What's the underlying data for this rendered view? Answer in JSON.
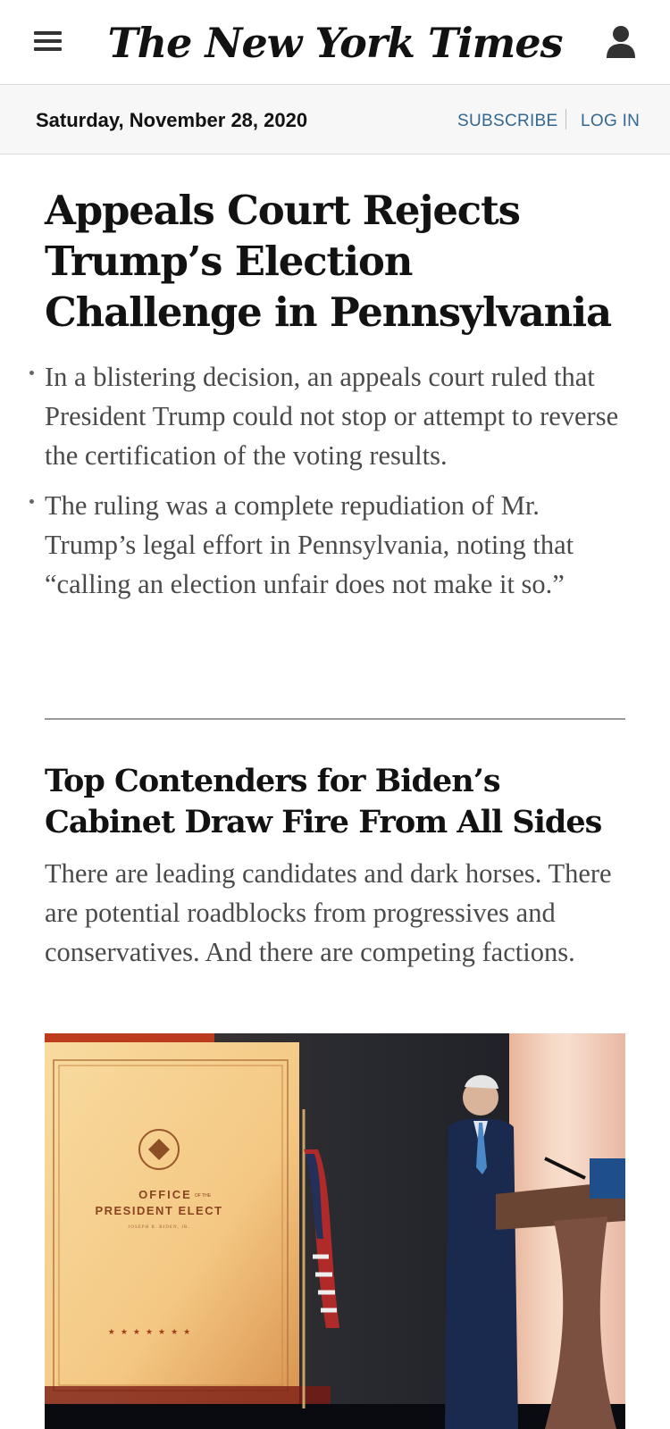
{
  "header": {
    "logo_text": "The New York Times",
    "menu_icon": "hamburger-menu-icon",
    "user_icon": "user-account-icon"
  },
  "datebar": {
    "date": "Saturday, November 28, 2020",
    "subscribe_label": "SUBSCRIBE",
    "login_label": "LOG IN"
  },
  "story1": {
    "headline": "Appeals Court Rejects Trump’s Election Challenge in Pennsylvania",
    "bullets": [
      "In a blistering decision, an appeals court ruled that President Trump could not stop or attempt to reverse the certification of the voting results.",
      "The ruling was a complete repudiation of Mr. Trump’s legal effort in Pennsylvania, noting that “calling an election unfair does not make it so.”"
    ]
  },
  "story2": {
    "headline": "Top Contenders for Biden’s Cabinet Draw Fire From All Sides",
    "summary": "There are leading candidates and dark horses. There are potential roadblocks from progressives and conservatives. And there are competing factions.",
    "image": {
      "sign_line1": "OFFICE",
      "sign_small": "OF THE",
      "sign_line2": "PRESIDENT ELECT",
      "sign_line3": "JOSEPH R. BIDEN, JR."
    }
  },
  "colors": {
    "link": "#326891",
    "headline": "#121212",
    "summary": "#4a4a4a"
  }
}
